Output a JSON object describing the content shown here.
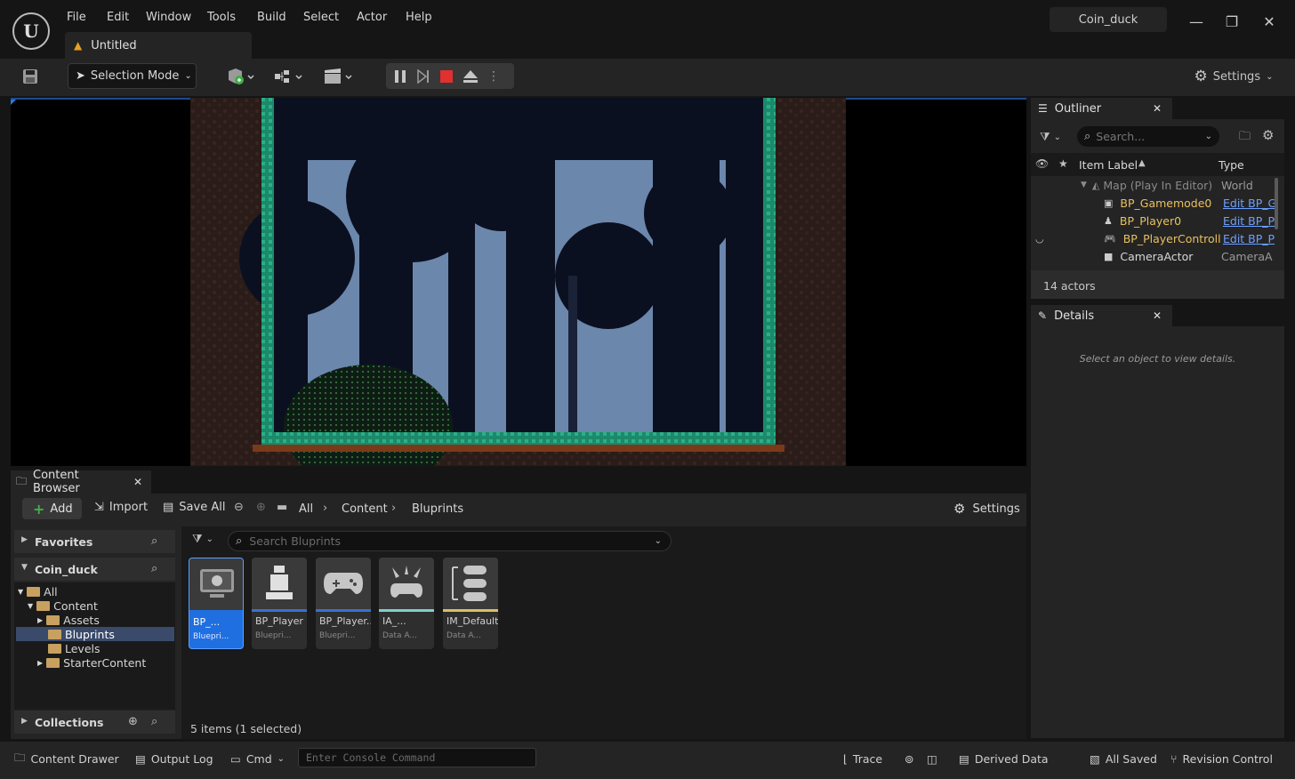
{
  "menu": [
    "File",
    "Edit",
    "Window",
    "Tools",
    "Build",
    "Select",
    "Actor",
    "Help"
  ],
  "tab": {
    "label": "Untitled"
  },
  "project": {
    "name": "Coin_duck"
  },
  "toolbar": {
    "selection_mode": "Selection Mode",
    "settings": "Settings"
  },
  "outliner": {
    "title": "Outliner",
    "search_placeholder": "Search...",
    "col_label": "Item Label",
    "col_type": "Type",
    "rows": [
      {
        "label": "Map (Play In Editor)",
        "type": "World"
      },
      {
        "label": "BP_Gamemode0",
        "type": "Edit BP_G"
      },
      {
        "label": "BP_Player0",
        "type": "Edit BP_P"
      },
      {
        "label": "BP_PlayerControll",
        "type": "Edit BP_P"
      },
      {
        "label": "CameraActor",
        "type": "CameraA"
      }
    ],
    "count": "14 actors"
  },
  "details": {
    "title": "Details",
    "empty": "Select an object to view details."
  },
  "content_browser": {
    "title": "Content Browser",
    "add": "Add",
    "import": "Import",
    "save_all": "Save All",
    "crumbs": [
      "All",
      "Content",
      "Bluprints"
    ],
    "settings": "Settings",
    "favorites": "Favorites",
    "project": "Coin_duck",
    "collections": "Collections",
    "search_placeholder": "Search Bluprints",
    "tree": [
      "All",
      "Content",
      "Assets",
      "Bluprints",
      "Levels",
      "StarterContent"
    ],
    "assets": [
      {
        "name": "BP_...",
        "type": "Bluepri...",
        "color": "#1f6fe0"
      },
      {
        "name": "BP_Player",
        "type": "Bluepri...",
        "color": "#3b6fd0"
      },
      {
        "name": "BP_Player...",
        "type": "Bluepri...",
        "color": "#3b6fd0"
      },
      {
        "name": "IA_...",
        "type": "Data A...",
        "color": "#7fd0c8"
      },
      {
        "name": "IM_Default",
        "type": "Data A...",
        "color": "#d8c060"
      }
    ],
    "status": "5 items (1 selected)"
  },
  "statusbar": {
    "content_drawer": "Content Drawer",
    "output_log": "Output Log",
    "cmd": "Cmd",
    "console_placeholder": "Enter Console Command",
    "trace": "Trace",
    "derived_data": "Derived Data",
    "all_saved": "All Saved",
    "revision_control": "Revision Control"
  }
}
